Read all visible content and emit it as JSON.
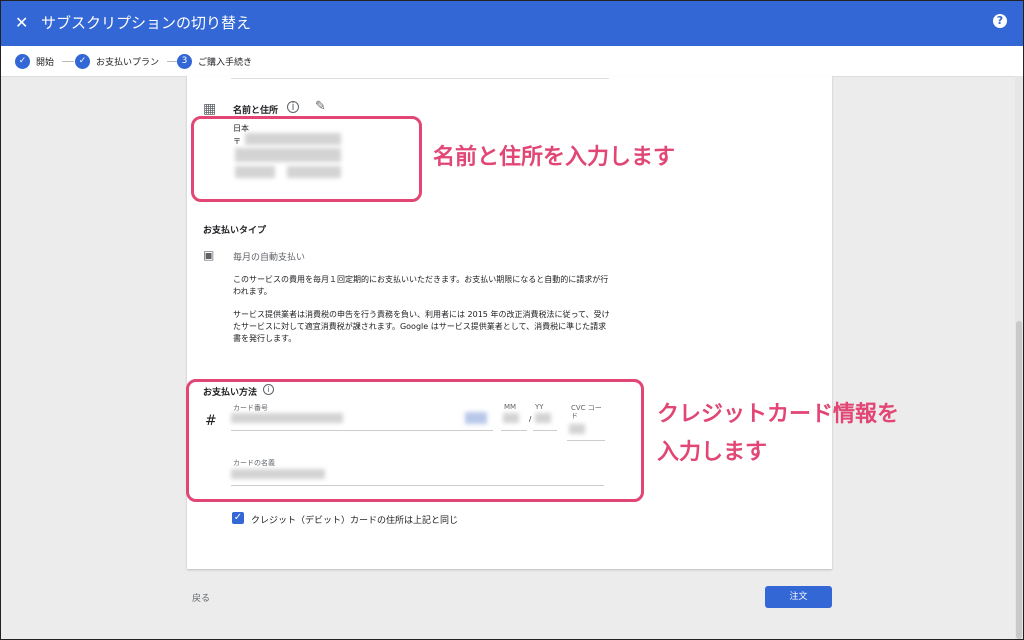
{
  "header": {
    "close_icon": "close-icon",
    "title": "サブスクリプションの切り替え",
    "help_icon": "help-icon",
    "help_glyph": "?"
  },
  "stepper": {
    "steps": [
      {
        "label": "開始",
        "state": "done",
        "marker": "✓"
      },
      {
        "label": "お支払いプラン",
        "state": "done",
        "marker": "✓"
      },
      {
        "label": "ご購入手続き",
        "state": "current",
        "marker": "3"
      }
    ]
  },
  "name_address": {
    "label": "名前と住所",
    "icon": "building-icon",
    "country": "日本",
    "postal_prefix": "〒"
  },
  "payment_type": {
    "heading": "お支払いタイプ",
    "icon": "calendar-icon",
    "value": "毎月の自動支払い",
    "para1": "このサービスの費用を毎月１回定期的にお支払いいただきます。お支払い期限になると自動的に請求が行われます。",
    "para2": "サービス提供業者は消費税の申告を行う責務を負い、利用者には 2015 年の改正消費税法に従って、受けたサービスに対して適宜消費税が課されます。Google はサービス提供業者として、消費税に準じた請求書を発行します。"
  },
  "payment_method": {
    "heading": "お支払い方法",
    "card_number_label": "カード番号",
    "hash_glyph": "#",
    "mm_label": "MM",
    "yy_label": "YY",
    "slash": "/",
    "cvc_label": "CVC コード",
    "cardholder_label": "カードの名義"
  },
  "billing_same": {
    "label": "クレジット（デビット）カードの住所は上記と同じ",
    "checked": true
  },
  "footer": {
    "back": "戻る",
    "order": "注文"
  },
  "annotations": {
    "name_note": "名前と住所を入力します",
    "card_note_line1": "クレジットカード情報を",
    "card_note_line2": "入力します"
  },
  "colors": {
    "primary": "#3367d6",
    "annotation": "#e14675"
  }
}
